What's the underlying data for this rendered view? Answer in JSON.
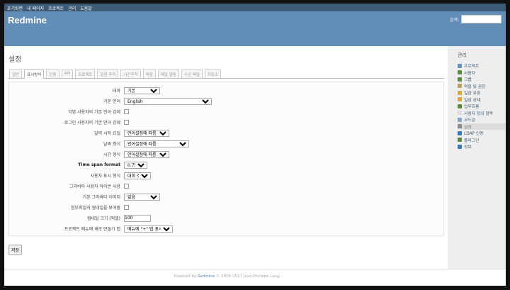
{
  "topmenu": [
    "초기화면",
    "내 페이지",
    "프로젝트",
    "관리",
    "도움말"
  ],
  "header": {
    "title": "Redmine",
    "search_label": "검색:",
    "search_value": ""
  },
  "page": {
    "title": "설정"
  },
  "tabs": [
    {
      "label": "일반",
      "selected": false
    },
    {
      "label": "표시방식",
      "selected": true
    },
    {
      "label": "인증",
      "selected": false
    },
    {
      "label": "API",
      "selected": false
    },
    {
      "label": "프로젝트",
      "selected": false
    },
    {
      "label": "일감 추적",
      "selected": false
    },
    {
      "label": "시간추적",
      "selected": false
    },
    {
      "label": "파일",
      "selected": false
    },
    {
      "label": "메일 알림",
      "selected": false
    },
    {
      "label": "수신 메일",
      "selected": false
    },
    {
      "label": "저장소",
      "selected": false
    }
  ],
  "form": {
    "theme": {
      "label": "테마",
      "value": "기본"
    },
    "language": {
      "label": "기본 언어",
      "value": "English"
    },
    "force_anon": {
      "label": "익명 사용자의 기본 언어 강제"
    },
    "force_login": {
      "label": "로그인 사용자의 기본 언어 강제"
    },
    "start_day": {
      "label": "달력 시작 요일",
      "value": "언어설정에 따름"
    },
    "date_format": {
      "label": "날짜 형식",
      "value": "언어설정에 따름"
    },
    "time_format": {
      "label": "시간 형식",
      "value": "언어설정에 따름"
    },
    "timespan": {
      "label": "Time span format",
      "value": "0.75"
    },
    "user_format": {
      "label": "사용자 표시 형식",
      "value": "대회 갓"
    },
    "gravatar": {
      "label": "그라바타 사용자 아이콘 사용"
    },
    "gravatar_default": {
      "label": "기본 그라바타 이미지",
      "value": "없음"
    },
    "thumbnails": {
      "label": "첨부파일의 썸네일을 보여줌"
    },
    "thumb_size": {
      "label": "썸네일 크기 (픽셀)",
      "value": "100"
    },
    "new_item_menu": {
      "label": "프로젝트 메뉴에 새로 만들기 탭",
      "value": "메뉴에 \"+\" 탭 표시"
    }
  },
  "save_label": "저장",
  "sidebar": {
    "title": "관리",
    "items": [
      {
        "label": "프로젝트",
        "icon": "projects-icon",
        "color": "#6a8fb5"
      },
      {
        "label": "사용자",
        "icon": "users-icon",
        "color": "#5b8a3c"
      },
      {
        "label": "그룹",
        "icon": "group-icon",
        "color": "#5b8a3c"
      },
      {
        "label": "역할 및 권한",
        "icon": "roles-icon",
        "color": "#b9a25d"
      },
      {
        "label": "일감 유형",
        "icon": "trackers-icon",
        "color": "#d8a83a"
      },
      {
        "label": "일감 상태",
        "icon": "issue-status-icon",
        "color": "#d8a83a"
      },
      {
        "label": "업무흐름",
        "icon": "workflow-icon",
        "color": "#5b8a3c"
      },
      {
        "label": "사용자 정의 항목",
        "icon": "custom-fields-icon",
        "color": "#dddddd"
      },
      {
        "label": "코드값",
        "icon": "enumerations-icon",
        "color": "#8aa4c6"
      },
      {
        "label": "설정",
        "icon": "settings-icon",
        "color": "#8a8a8a",
        "selected": true
      },
      {
        "label": "LDAP 인증",
        "icon": "ldap-icon",
        "color": "#3a78b7"
      },
      {
        "label": "플러그인",
        "icon": "plugins-icon",
        "color": "#5b8a3c"
      },
      {
        "label": "정보",
        "icon": "info-icon",
        "color": "#3a78b7"
      }
    ]
  },
  "footer": {
    "prefix": "Powered by ",
    "link": "Redmine",
    "suffix": " © 2006-2017 Jean-Philippe Lang"
  }
}
